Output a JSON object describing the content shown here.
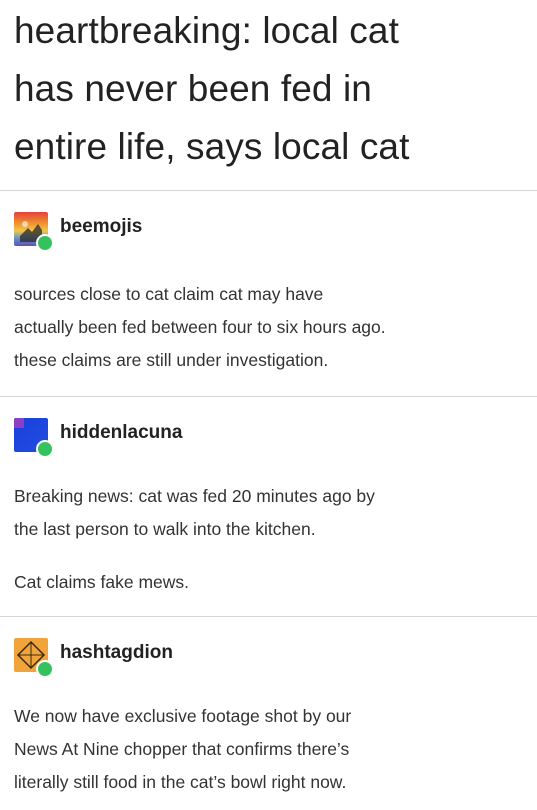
{
  "title_lines": [
    "heartbreaking: local cat",
    "has never been fed in",
    "entire life, says local cat"
  ],
  "reblogs": [
    {
      "username": "beemojis",
      "avatar_icon": "rainbow-avatar-icon",
      "paragraphs": [
        [
          "sources close to cat claim cat may have",
          "actually been fed between four to six hours ago.",
          "these claims are still under investigation."
        ]
      ]
    },
    {
      "username": "hiddenlacuna",
      "avatar_icon": "blue-avatar-icon",
      "paragraphs": [
        [
          "Breaking news: cat was fed 20 minutes ago by",
          "the last person to walk into the kitchen."
        ],
        [
          "Cat claims fake mews."
        ]
      ]
    },
    {
      "username": "hashtagdion",
      "avatar_icon": "orange-avatar-icon",
      "paragraphs": [
        [
          "We now have exclusive footage shot by our",
          "News At Nine chopper that confirms there’s",
          "literally still food in the cat’s bowl right now."
        ]
      ]
    }
  ],
  "colors": {
    "reblog_badge": "#35c25e",
    "divider": "#d6d6d6",
    "text": "#333333"
  }
}
